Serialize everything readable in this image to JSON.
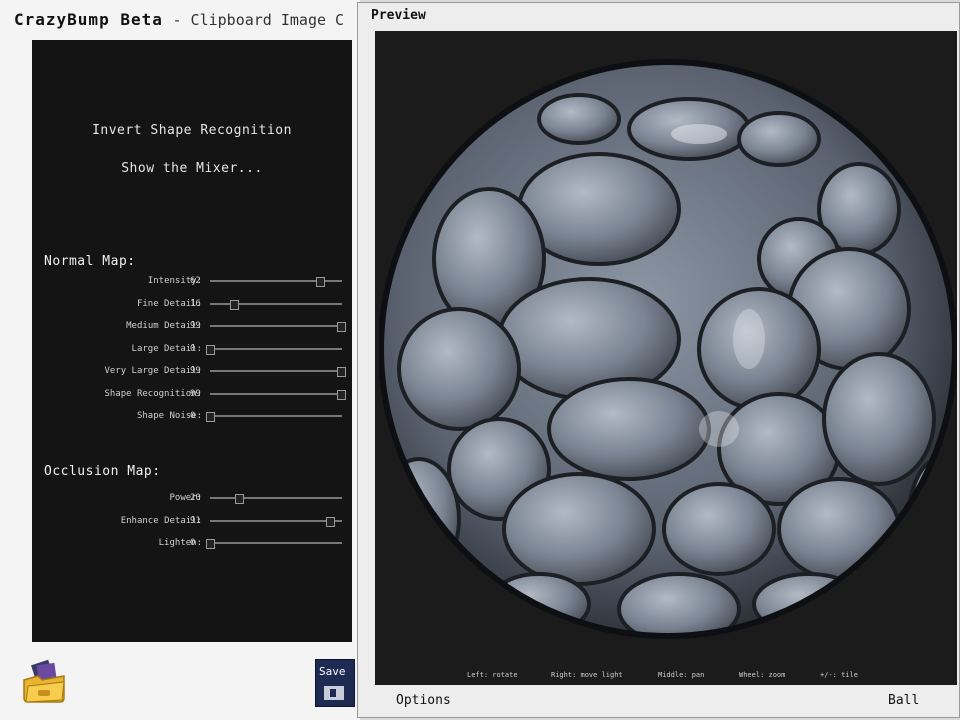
{
  "main": {
    "app_title": "CrazyBump Beta",
    "subtitle": "- Clipboard Image C",
    "invert_link": "Invert Shape Recognition",
    "mixer_link": "Show the Mixer...",
    "normal_header": "Normal Map:",
    "occlusion_header": "Occlusion Map:",
    "normal_sliders": [
      {
        "label": "Intensity:",
        "value": "62",
        "level": 0.83
      },
      {
        "label": "Fine Detail:",
        "value": "16",
        "level": 0.18
      },
      {
        "label": "Medium Detail:",
        "value": "99",
        "level": 0.99
      },
      {
        "label": "Large Detail:",
        "value": "0",
        "level": 0.0
      },
      {
        "label": "Very Large Detail:",
        "value": "99",
        "level": 0.99
      },
      {
        "label": "Shape Recognition:",
        "value": "99",
        "level": 0.99
      },
      {
        "label": "Shape Noise:",
        "value": "0",
        "level": 0.0
      }
    ],
    "occlusion_sliders": [
      {
        "label": "Power:",
        "value": "20",
        "level": 0.22
      },
      {
        "label": "Enhance Detail:",
        "value": "91",
        "level": 0.91
      },
      {
        "label": "Lighten:",
        "value": "0",
        "level": 0.0
      }
    ],
    "save_label": "Save"
  },
  "preview": {
    "title": "Preview",
    "hints": [
      "Left: rotate",
      "Right: move light",
      "Middle: pan",
      "Wheel: zoom",
      "+/-: tile"
    ],
    "options_label": "Options",
    "ball_label": "Ball"
  },
  "colors": {
    "panel_bg": "#141414",
    "viewport_bg": "#1b1b1b",
    "stone_base": "#6f7784",
    "save_button": "#1d2a52"
  }
}
